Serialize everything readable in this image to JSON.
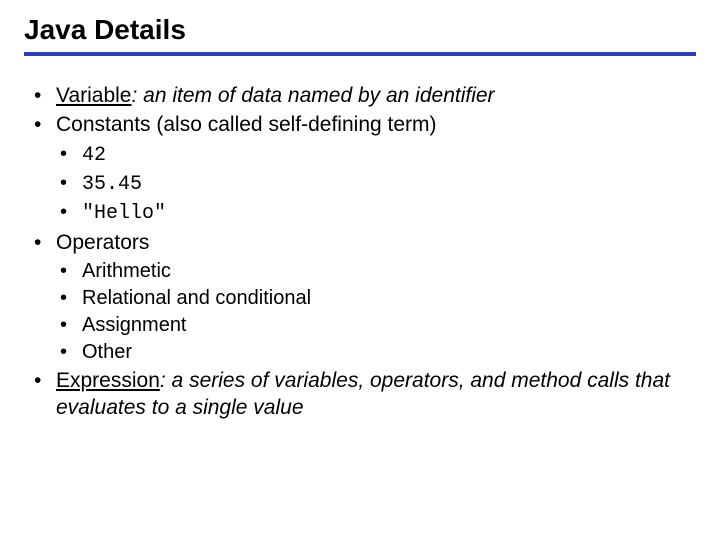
{
  "title": "Java Details",
  "bullets": {
    "variable_label": "Variable",
    "variable_rest": ": an item of data named by an identifier",
    "constants": "Constants (also called self-defining term)",
    "const_items": [
      "42",
      "35.45",
      "\"Hello\""
    ],
    "operators": "Operators",
    "op_items": [
      "Arithmetic",
      "Relational and conditional",
      "Assignment",
      "Other"
    ],
    "expression_label": "Expression",
    "expression_rest": ": a series of variables, operators, and method calls that evaluates to a single value"
  }
}
